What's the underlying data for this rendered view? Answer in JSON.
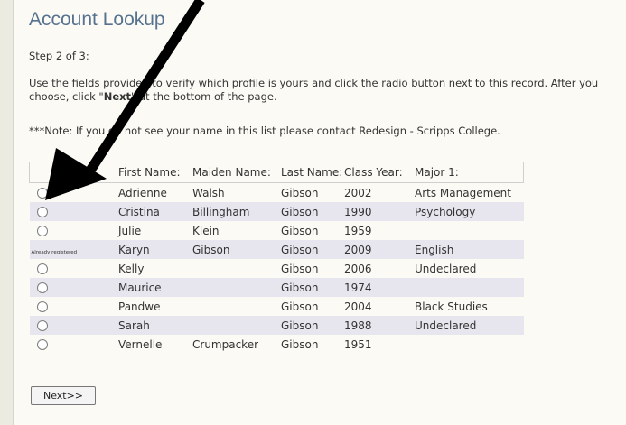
{
  "page": {
    "title": "Account Lookup",
    "step": "Step 2 of 3:",
    "instructions_part1": "Use the fields provided to verify which profile is yours and click the radio button next to this record. After you choose, click \"",
    "instructions_bold": "Next",
    "instructions_part2": "\" at the bottom of the page.",
    "note": "***Note: If you do not see your name in this list please contact Redesign - Scripps College."
  },
  "table": {
    "headers": [
      "",
      "First Name:",
      "Maiden Name:",
      "Last Name:",
      "Class Year:",
      "Major 1:"
    ],
    "rows": [
      {
        "status": "radio",
        "first": "Adrienne",
        "maiden": "Walsh",
        "last": "Gibson",
        "year": "2002",
        "major": "Arts Management"
      },
      {
        "status": "radio",
        "first": "Cristina",
        "maiden": "Billingham",
        "last": "Gibson",
        "year": "1990",
        "major": "Psychology"
      },
      {
        "status": "radio",
        "first": "Julie",
        "maiden": "Klein",
        "last": "Gibson",
        "year": "1959",
        "major": ""
      },
      {
        "status": "Already registered",
        "first": "Karyn",
        "maiden": "Gibson",
        "last": "Gibson",
        "year": "2009",
        "major": "English"
      },
      {
        "status": "radio",
        "first": "Kelly",
        "maiden": "",
        "last": "Gibson",
        "year": "2006",
        "major": "Undeclared"
      },
      {
        "status": "radio",
        "first": "Maurice",
        "maiden": "",
        "last": "Gibson",
        "year": "1974",
        "major": ""
      },
      {
        "status": "radio",
        "first": "Pandwe",
        "maiden": "",
        "last": "Gibson",
        "year": "2004",
        "major": "Black Studies"
      },
      {
        "status": "radio",
        "first": "Sarah",
        "maiden": "",
        "last": "Gibson",
        "year": "1988",
        "major": "Undeclared"
      },
      {
        "status": "radio",
        "first": "Vernelle",
        "maiden": "Crumpacker",
        "last": "Gibson",
        "year": "1951",
        "major": ""
      }
    ]
  },
  "buttons": {
    "next_label": "Next>>"
  },
  "icons": {
    "annotation": "arrow-icon"
  },
  "colors": {
    "title": "#56728f",
    "row_alt": "#e7e6ef",
    "background": "#fbfaf4"
  }
}
